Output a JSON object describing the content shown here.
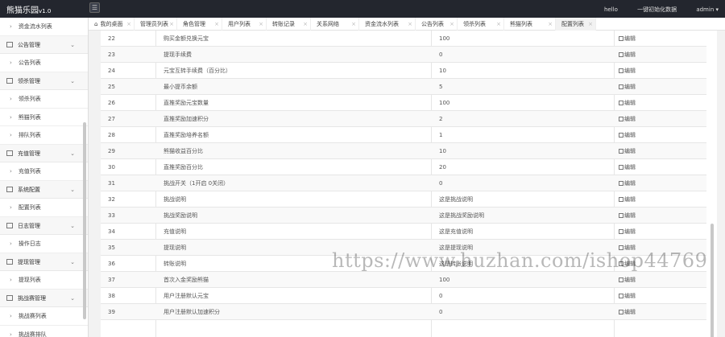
{
  "app": {
    "title": "熊猫乐园",
    "version": "v1.0"
  },
  "topbar": {
    "user_greeting": "hello",
    "format_data": "一键初始化数据",
    "admin": "admin ▾"
  },
  "sidebar": {
    "items": [
      {
        "kind": "sub",
        "label": "资金流水列表"
      },
      {
        "kind": "head",
        "label": "公告管理"
      },
      {
        "kind": "sub",
        "label": "公告列表"
      },
      {
        "kind": "head",
        "label": "领杀管理"
      },
      {
        "kind": "sub",
        "label": "领杀列表"
      },
      {
        "kind": "sub",
        "label": "熊猫列表"
      },
      {
        "kind": "sub",
        "label": "排队列表"
      },
      {
        "kind": "head",
        "label": "充值管理"
      },
      {
        "kind": "sub",
        "label": "充值列表"
      },
      {
        "kind": "head",
        "label": "系统配置"
      },
      {
        "kind": "sub",
        "label": "配置列表"
      },
      {
        "kind": "head",
        "label": "日志管理"
      },
      {
        "kind": "sub",
        "label": "操作日志"
      },
      {
        "kind": "head",
        "label": "提现管理"
      },
      {
        "kind": "sub",
        "label": "提现列表"
      },
      {
        "kind": "head",
        "label": "挑战赛管理"
      },
      {
        "kind": "sub",
        "label": "挑战赛列表"
      },
      {
        "kind": "sub",
        "label": "挑战赛排队"
      }
    ]
  },
  "tabs": [
    {
      "label": "我的桌面",
      "active": false,
      "home": true
    },
    {
      "label": "管理员列表",
      "active": false
    },
    {
      "label": "角色管理",
      "active": false
    },
    {
      "label": "用户列表",
      "active": false
    },
    {
      "label": "转账记录",
      "active": false
    },
    {
      "label": "关系网络",
      "active": false
    },
    {
      "label": "资金流水列表",
      "active": false
    },
    {
      "label": "公告列表",
      "active": false
    },
    {
      "label": "领杀列表",
      "active": false
    },
    {
      "label": "熊猫列表",
      "active": false
    },
    {
      "label": "配置列表",
      "active": true
    }
  ],
  "table": {
    "action_label": "编辑",
    "rows": [
      {
        "id": "22",
        "name": "购买金额兑换元宝",
        "value": "100"
      },
      {
        "id": "23",
        "name": "提现手续费",
        "value": "0"
      },
      {
        "id": "24",
        "name": "元宝互转手续费（百分比）",
        "value": "10"
      },
      {
        "id": "25",
        "name": "最小提币余额",
        "value": "5"
      },
      {
        "id": "26",
        "name": "直推奖励元宝数量",
        "value": "100"
      },
      {
        "id": "27",
        "name": "直推奖励加速积分",
        "value": "2"
      },
      {
        "id": "28",
        "name": "直推奖励培养名额",
        "value": "1"
      },
      {
        "id": "29",
        "name": "熊猫收益百分比",
        "value": "10"
      },
      {
        "id": "30",
        "name": "直推奖励百分比",
        "value": "20"
      },
      {
        "id": "31",
        "name": "挑战开关（1开启 0关闭）",
        "value": "0"
      },
      {
        "id": "32",
        "name": "挑战说明",
        "value": "这是挑战说明"
      },
      {
        "id": "33",
        "name": "挑战奖励说明",
        "value": "这是挑战奖励说明"
      },
      {
        "id": "34",
        "name": "充值说明",
        "value": "这是充值说明"
      },
      {
        "id": "35",
        "name": "提现说明",
        "value": "这是提现说明"
      },
      {
        "id": "36",
        "name": "转账说明",
        "value": "这是转账说明"
      },
      {
        "id": "37",
        "name": "首次入金奖励熊猫",
        "value": "100"
      },
      {
        "id": "38",
        "name": "用户注册默认元宝",
        "value": "0"
      },
      {
        "id": "39",
        "name": "用户注册默认加速积分",
        "value": "0"
      }
    ]
  },
  "watermark": "https://www.huzhan.com/ishop44769"
}
